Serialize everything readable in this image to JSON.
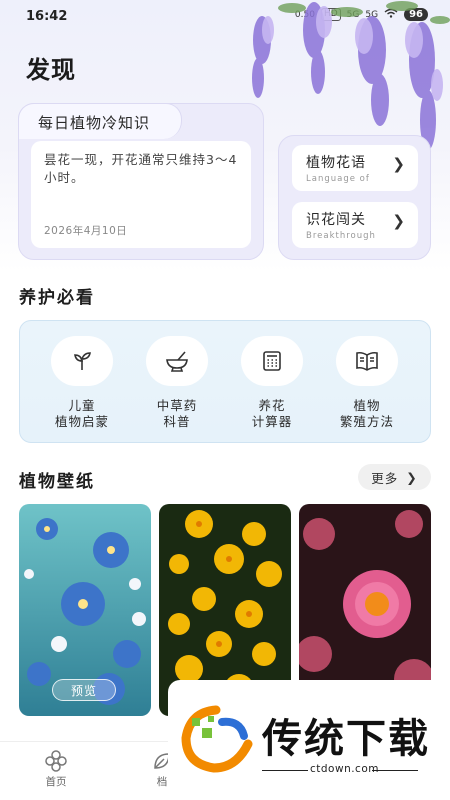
{
  "status_bar": {
    "time": "16:42",
    "speed": "0.50",
    "chip1": "HD",
    "chip2": "5G",
    "chip3": "5G",
    "battery": "96"
  },
  "page": {
    "title": "发现"
  },
  "daily_fact": {
    "title": "每日植物冷知识",
    "text": "昙花一现，开花通常只维持3～4小时。",
    "date": "2026年4月10日"
  },
  "side_entries": [
    {
      "label": "植物花语",
      "sub": "Language of",
      "icon": "chevron-right"
    },
    {
      "label": "识花闯关",
      "sub": "Breakthrough",
      "icon": "chevron-right"
    }
  ],
  "care": {
    "title": "养护必看",
    "items": [
      {
        "line1": "儿童",
        "line2": "植物启蒙",
        "icon": "sprout"
      },
      {
        "line1": "中草药",
        "line2": "科普",
        "icon": "mortar-pestle"
      },
      {
        "line1": "养花",
        "line2": "计算器",
        "icon": "calculator"
      },
      {
        "line1": "植物",
        "line2": "繁殖方法",
        "icon": "open-book"
      }
    ]
  },
  "wallpapers": {
    "title": "植物壁纸",
    "more_label": "更多",
    "preview_label": "预览",
    "items": [
      "blue-forget-me-not",
      "yellow-flowers",
      "pink-strawflower"
    ]
  },
  "bottom_nav": [
    {
      "label": "首页",
      "icon": "flower-outline"
    },
    {
      "label": "档",
      "icon": "leaf-outline"
    }
  ],
  "watermark": {
    "text": "传统下载",
    "url": "ctdown.com"
  },
  "colors": {
    "accent_purple": "#ecebfa",
    "care_bg": "#e6f2fa",
    "wisteria": "#9b86e0"
  }
}
